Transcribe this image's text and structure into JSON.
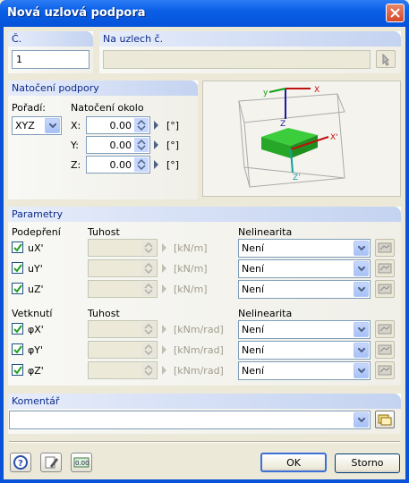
{
  "window": {
    "title": "Nová uzlová podpora"
  },
  "number": {
    "label": "Č.",
    "value": "1"
  },
  "nodes": {
    "label": "Na uzlech č.",
    "value": ""
  },
  "rotation": {
    "group_label": "Natočení podpory",
    "order_label": "Pořadí:",
    "order_value": "XYZ",
    "about_label": "Natočení okolo",
    "axes": [
      {
        "label": "X:",
        "value": "0.00",
        "unit": "[°]"
      },
      {
        "label": "Y:",
        "value": "0.00",
        "unit": "[°]"
      },
      {
        "label": "Z:",
        "value": "0.00",
        "unit": "[°]"
      }
    ]
  },
  "preview": {
    "axis_labels": {
      "y": "y",
      "x": "X",
      "x_prime": "X'",
      "z": "Z",
      "z_prime": "Z'"
    }
  },
  "params": {
    "group_label": "Parametry",
    "support_header": "Podepření",
    "stiffness_header": "Tuhost",
    "nonlin_header": "Nelinearita",
    "supports": [
      {
        "label": "uX'",
        "checked": true,
        "unit": "[kN/m]",
        "nonlin": "Není"
      },
      {
        "label": "uY'",
        "checked": true,
        "unit": "[kN/m]",
        "nonlin": "Není"
      },
      {
        "label": "uZ'",
        "checked": true,
        "unit": "[kN/m]",
        "nonlin": "Není"
      }
    ],
    "restraint_header": "Vetknutí",
    "restraints": [
      {
        "label": "φX'",
        "checked": true,
        "unit": "[kNm/rad]",
        "nonlin": "Není"
      },
      {
        "label": "φY'",
        "checked": true,
        "unit": "[kNm/rad]",
        "nonlin": "Není"
      },
      {
        "label": "φZ'",
        "checked": true,
        "unit": "[kNm/rad]",
        "nonlin": "Není"
      }
    ]
  },
  "comment": {
    "label": "Komentář",
    "value": ""
  },
  "buttons": {
    "ok": "OK",
    "cancel": "Storno"
  },
  "icons": [
    "help-icon",
    "edit-icon",
    "units-icon",
    "pick-node-icon",
    "library-icon"
  ]
}
